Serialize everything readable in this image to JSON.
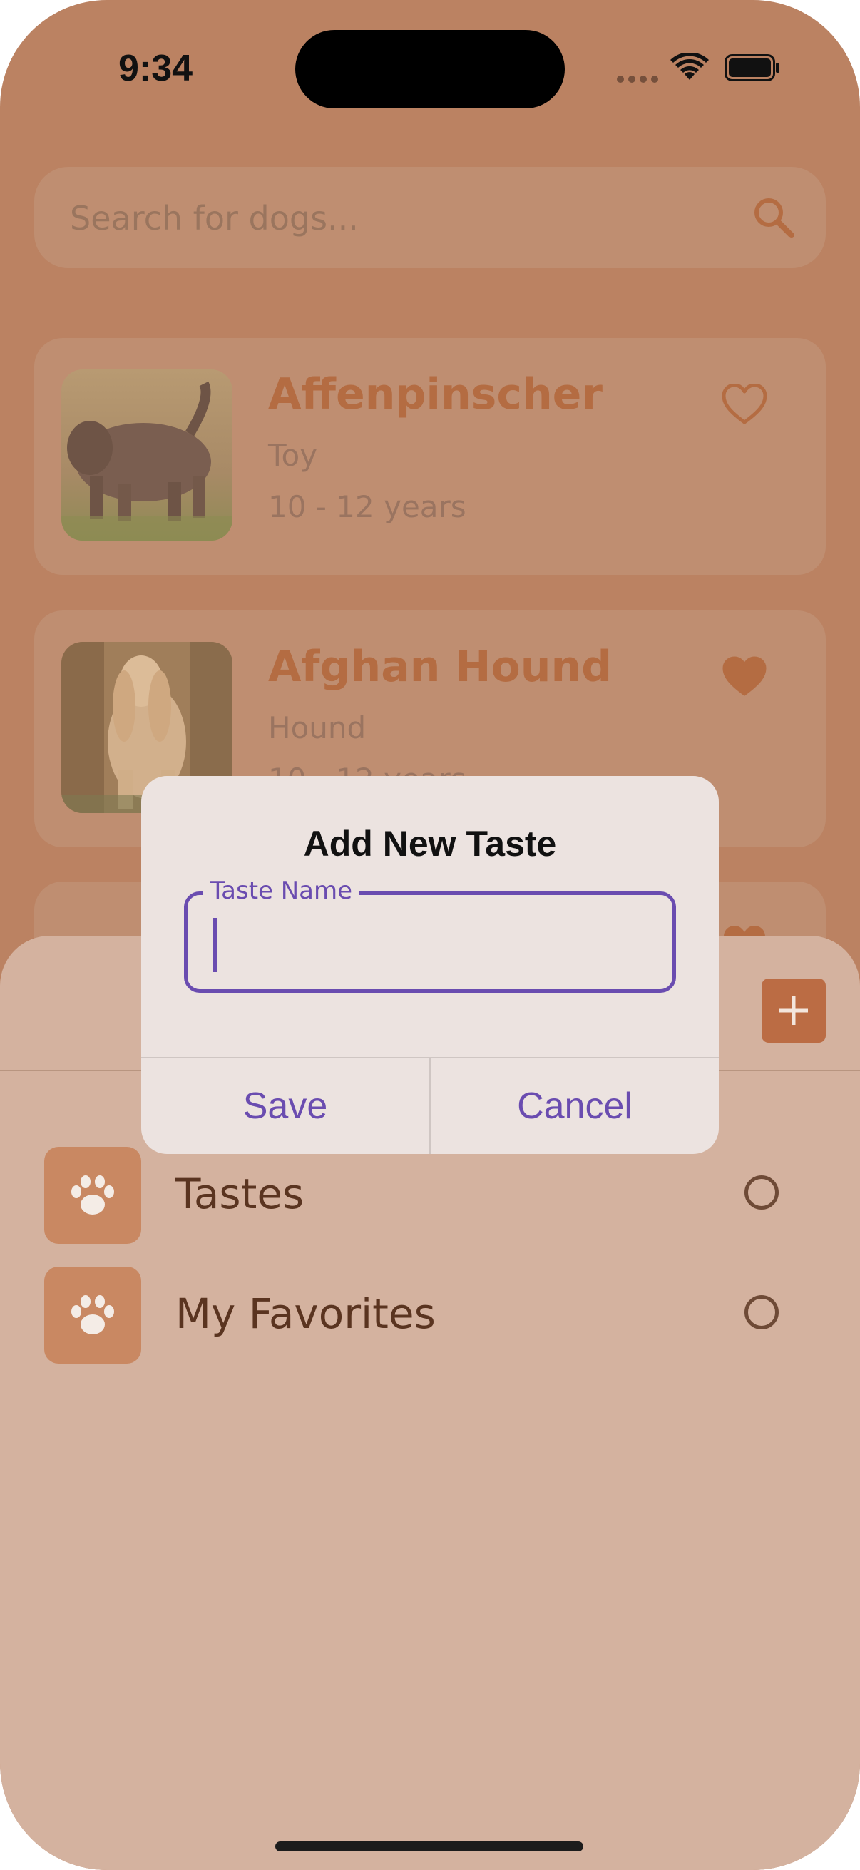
{
  "status_bar": {
    "time": "9:34"
  },
  "search": {
    "placeholder": "Search for dogs..."
  },
  "dogs": [
    {
      "name": "Affenpinscher",
      "group": "Toy",
      "life_span": "10 - 12 years",
      "favorite": false
    },
    {
      "name": "Afghan Hound",
      "group": "Hound",
      "life_span": "10 - 12 years",
      "favorite": true
    }
  ],
  "sheet": {
    "items": [
      {
        "label": "Tastes",
        "icon": "paw-icon"
      },
      {
        "label": "My Favorites",
        "icon": "paw-icon"
      }
    ]
  },
  "dialog": {
    "title": "Add New Taste",
    "field_label": "Taste Name",
    "field_value": "",
    "save_label": "Save",
    "cancel_label": "Cancel"
  },
  "colors": {
    "background": "#bb8262",
    "card": "#bf8e71",
    "accent": "#b46c42",
    "sheet": "#d4b29f",
    "dialog_accent": "#6a4cb0"
  }
}
